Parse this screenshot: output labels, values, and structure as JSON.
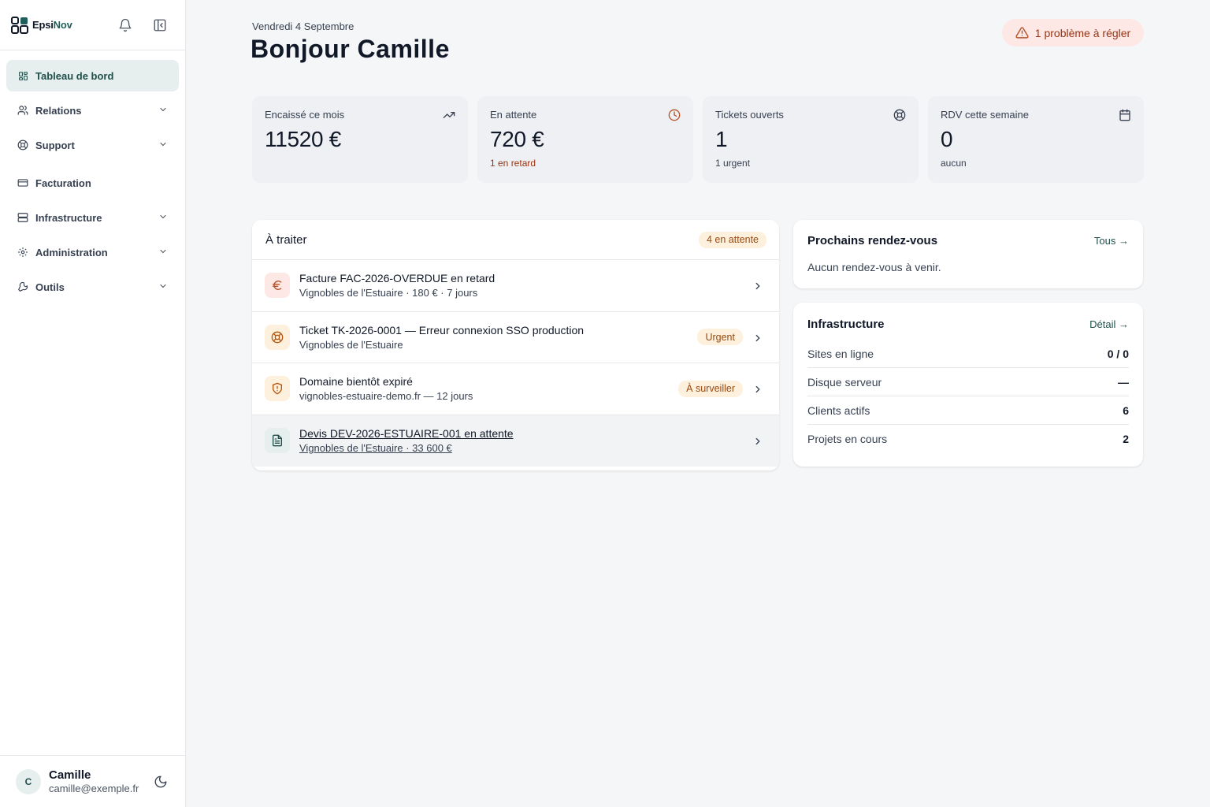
{
  "app": {
    "name_a": "Epsi",
    "name_b": "Nov"
  },
  "sidebar": {
    "items": [
      {
        "label": "Tableau de bord",
        "icon": "grid-icon",
        "active": true
      },
      {
        "label": "Relations",
        "icon": "users-icon"
      },
      {
        "label": "Support",
        "icon": "lifebuoy-icon"
      },
      {
        "label": "Facturation",
        "icon": "card-icon"
      },
      {
        "label": "Infrastructure",
        "icon": "server-icon"
      },
      {
        "label": "Administration",
        "icon": "gear-icon"
      },
      {
        "label": "Outils",
        "icon": "wrench-icon"
      }
    ],
    "user": {
      "initial": "C",
      "name": "Camille",
      "email": "camille@exemple.fr"
    }
  },
  "header": {
    "date": "Vendredi 4 Septembre",
    "greeting": "Bonjour Camille",
    "alert": "1 problème à régler"
  },
  "stats": [
    {
      "label": "Encaissé ce mois",
      "value": "11520 €",
      "sub": "",
      "icon": "trend-up-icon"
    },
    {
      "label": "En attente",
      "value": "720 €",
      "sub": "1 en retard",
      "icon": "clock-icon"
    },
    {
      "label": "Tickets ouverts",
      "value": "1",
      "sub": "1 urgent",
      "icon": "lifebuoy-icon"
    },
    {
      "label": "RDV cette semaine",
      "value": "0",
      "sub": "aucun",
      "icon": "calendar-icon"
    }
  ],
  "todo": {
    "title": "À traiter",
    "badge": "4 en attente",
    "rows": [
      {
        "title": "Facture FAC-2026-OVERDUE en retard",
        "sub": "Vignobles de l'Estuaire · 180 € · 7 jours",
        "badge": "",
        "icon": "euro-icon"
      },
      {
        "title": "Ticket TK-2026-0001 — Erreur connexion SSO production",
        "sub": "Vignobles de l'Estuaire",
        "badge": "Urgent",
        "icon": "lifebuoy-icon"
      },
      {
        "title": "Domaine bientôt expiré",
        "sub": "vignobles-estuaire-demo.fr — 12 jours",
        "badge": "À surveiller",
        "icon": "shield-icon"
      },
      {
        "title": "Devis DEV-2026-ESTUAIRE-001 en attente",
        "sub": "Vignobles de l'Estuaire · 33 600 €",
        "badge": "",
        "icon": "document-icon"
      }
    ]
  },
  "appointments": {
    "title": "Prochains rendez-vous",
    "link": "Tous →",
    "empty": "Aucun rendez-vous à venir."
  },
  "infrastructure": {
    "title": "Infrastructure",
    "link": "Détail →",
    "rows": [
      {
        "label": "Sites en ligne",
        "value": "0 / 0"
      },
      {
        "label": "Disque serveur",
        "value": "—"
      },
      {
        "label": "Clients actifs",
        "value": "6"
      },
      {
        "label": "Projets en cours",
        "value": "2"
      }
    ]
  }
}
